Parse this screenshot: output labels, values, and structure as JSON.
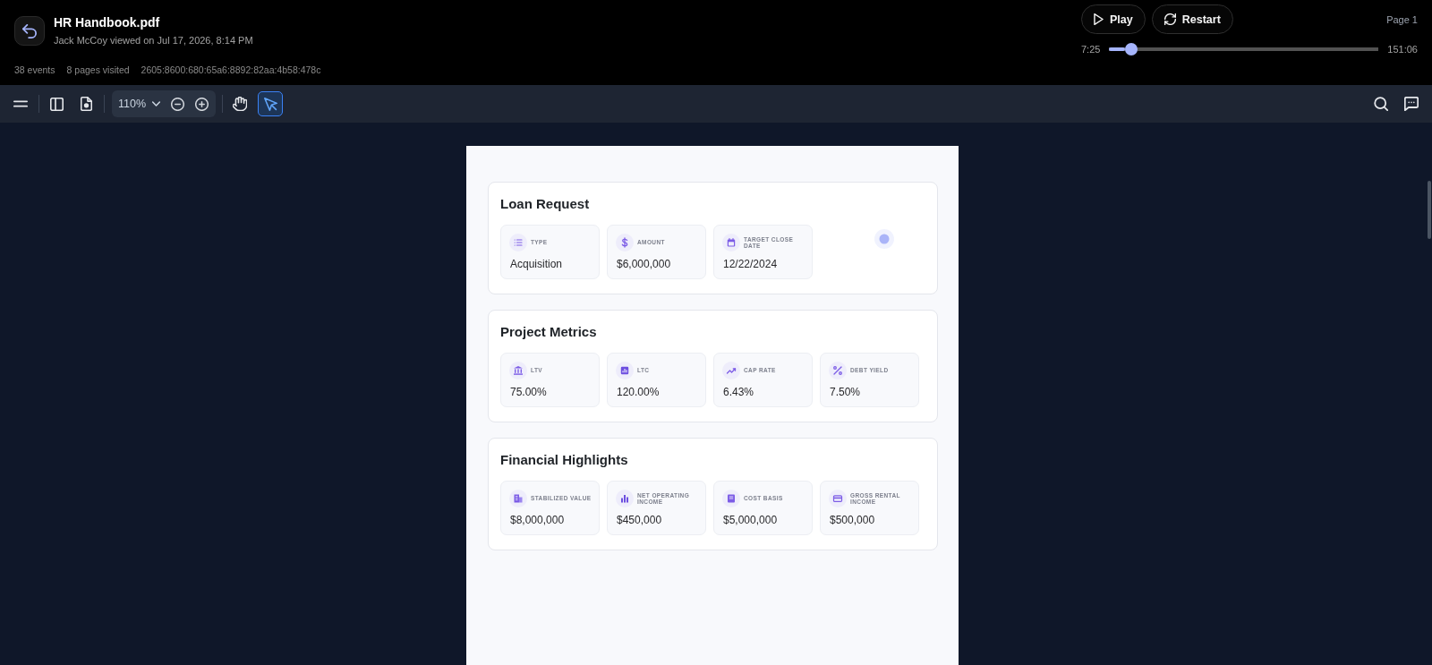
{
  "header": {
    "title": "HR Handbook.pdf",
    "subtitle": "Jack McCoy viewed on Jul 17, 2026, 8:14 PM",
    "stats": [
      "38 events",
      "8 pages visited",
      "2605:8600:680:65a6:8892:82aa:4b58:478c"
    ]
  },
  "player": {
    "buttons": [
      {
        "kind": "play",
        "label": "Play"
      },
      {
        "kind": "restart",
        "label": "Restart"
      }
    ],
    "page": "Page 1",
    "elapsed": "7:25",
    "duration": "151:06",
    "level": 0.06
  },
  "toolbar": {
    "zoom": "110%",
    "tools": [
      {
        "kind": "hand",
        "selected": false
      },
      {
        "kind": "pointer",
        "selected": true
      }
    ]
  },
  "document": {
    "sections": [
      {
        "title": "Loan Request",
        "metrics": [
          {
            "kind": "list",
            "label": "TYPE",
            "value": "Acquisition"
          },
          {
            "kind": "dollar",
            "label": "AMOUNT",
            "value": "$6,000,000"
          },
          {
            "kind": "calendar",
            "label": "TARGET CLOSE DATE",
            "value": "12/22/2024"
          }
        ]
      },
      {
        "title": "Project Metrics",
        "metrics": [
          {
            "kind": "bank",
            "label": "LTV",
            "value": "75.00%"
          },
          {
            "kind": "chart",
            "label": "LTC",
            "value": "120.00%"
          },
          {
            "kind": "trend",
            "label": "CAP RATE",
            "value": "6.43%"
          },
          {
            "kind": "percent",
            "label": "DEBT YIELD",
            "value": "7.50%"
          }
        ]
      },
      {
        "title": "Financial Highlights",
        "metrics": [
          {
            "kind": "building",
            "label": "STABILIZED VALUE",
            "value": "$8,000,000"
          },
          {
            "kind": "bars",
            "label": "NET OPERATING INCOME",
            "value": "$450,000"
          },
          {
            "kind": "receipt",
            "label": "COST BASIS",
            "value": "$5,000,000"
          },
          {
            "kind": "card",
            "label": "GROSS RENTAL INCOME",
            "value": "$500,000"
          }
        ]
      }
    ]
  }
}
